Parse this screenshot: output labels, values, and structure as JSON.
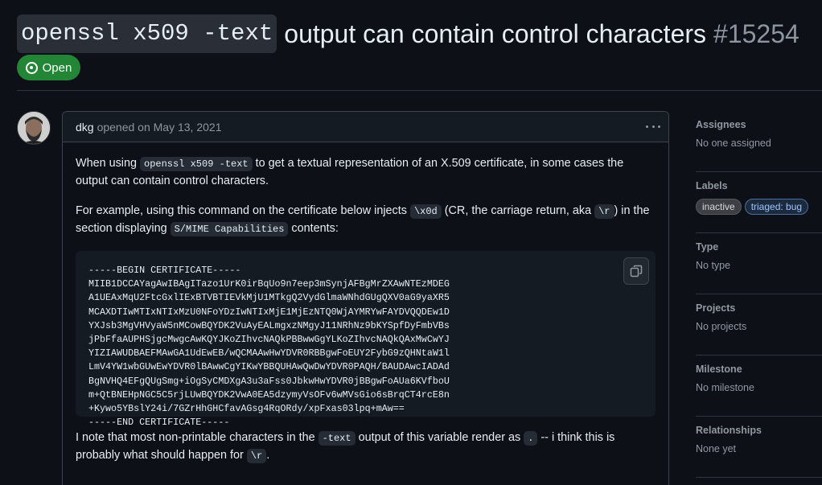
{
  "issue": {
    "title_code": "openssl x509 -text",
    "title_text": "output can contain control characters",
    "number": "#15254",
    "state": "Open"
  },
  "comment": {
    "author": "dkg",
    "meta": "opened on May 13, 2021",
    "p1": {
      "before": "When using ",
      "code": "openssl x509 -text",
      "after": " to get a textual representation of an X.509 certificate, in some cases the output can contain control characters."
    },
    "p2": {
      "before": "For example, using this command on the certificate below injects ",
      "code1": "\\x0d",
      "mid1": " (CR, the carriage return, aka ",
      "code2": "\\r",
      "mid2": ") in the section displaying ",
      "code3": "S/MIME Capabilities",
      "after": " contents:"
    },
    "certificate": "-----BEGIN CERTIFICATE-----\nMIIB1DCCAYagAwIBAgITazo1UrK0irBqUo9n7eep3mSynjAFBgMrZXAwNTEzMDEG\nA1UEAxMqU2FtcGxlIExBTVBTIEVkMjU1MTkgQ2VydGlmaWNhdGUgQXV0aG9yaXR5\nMCAXDTIwMTIxNTIxMzU0NFoYDzIwNTIxMjE1MjEzNTQ0WjAYMRYwFAYDVQQDEw1D\nYXJsb3MgVHVyaW5nMCowBQYDK2VuAyEALmgxzNMgyJ11NRhNz9bKYSpfDyFmbVBs\njPbFfaAUPHSjgcMwgcAwKQYJKoZIhvcNAQkPBBwwGgYLKoZIhvcNAQkQAxMwCwYJ\nYIZIAWUDBAEFMAwGA1UdEwEB/wQCMAAwHwYDVR0RBBgwFoEUY2FybG9zQHNtaW1l\nLmV4YW1wbGUwEwYDVR0lBAwwCgYIKwYBBQUHAwQwDwYDVR0PAQH/BAUDAwcIADAd\nBgNVHQ4EFgQUgSmg+iOgSyCMDXgA3u3aFss0JbkwHwYDVR0jBBgwFoAUa6KVfboU\nm+QtBNEHpNGC5C5rjLUwBQYDK2VwA0EA5dzymyVsOFv6wMVsGio6sBrqCT4rcE8n\n+Kywo5YBslY24i/7GZrHhGHCfavAGsg4RqORdy/xpFxas03lpq+mAw==\n-----END CERTIFICATE-----",
    "p3": {
      "before": "I note that most non-printable characters in the ",
      "code1": "-text",
      "mid1": " output of this variable render as ",
      "code2": ".",
      "mid2": " -- i think this is probably what should happen for ",
      "code3": "\\r",
      "after": "."
    }
  },
  "sidebar": {
    "assignees": {
      "heading": "Assignees",
      "value": "No one assigned"
    },
    "labels": {
      "heading": "Labels",
      "items": [
        "inactive",
        "triaged: bug"
      ]
    },
    "type": {
      "heading": "Type",
      "value": "No type"
    },
    "projects": {
      "heading": "Projects",
      "value": "No projects"
    },
    "milestone": {
      "heading": "Milestone",
      "value": "No milestone"
    },
    "relationships": {
      "heading": "Relationships",
      "value": "None yet"
    }
  },
  "colors": {
    "open_badge": "#238636",
    "background": "#0d1117",
    "border": "#3d444d"
  },
  "icons": [
    "open-issue-icon",
    "kebab-menu-icon",
    "copy-icon"
  ]
}
